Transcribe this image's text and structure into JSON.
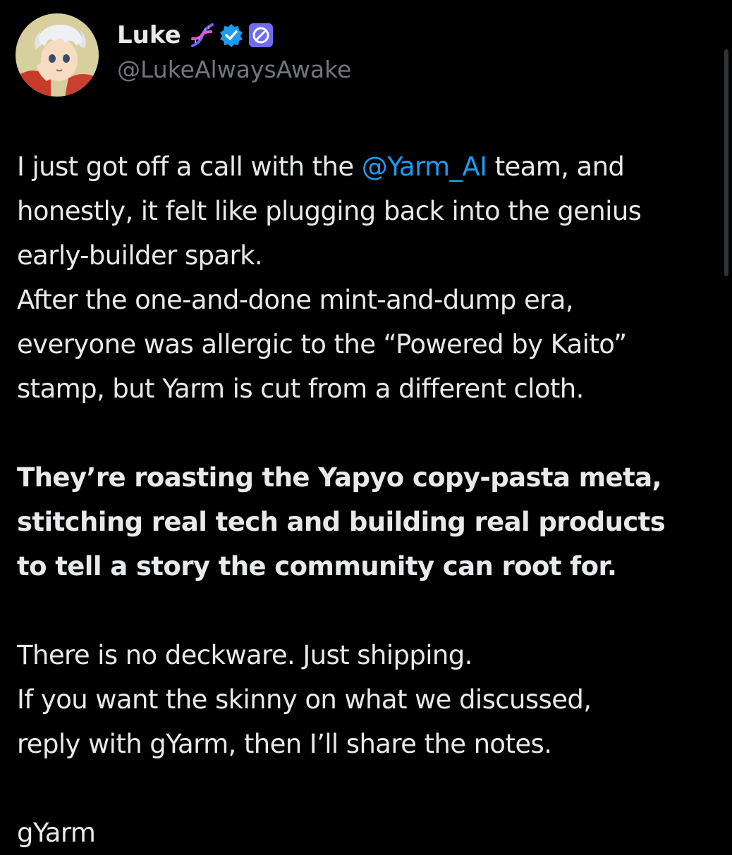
{
  "author": {
    "display_name": "Luke",
    "handle": "@LukeAlwaysAwake",
    "avatar_icon": "anime-avatar",
    "badges": [
      "dna-emoji-icon",
      "verified-badge-icon",
      "affiliate-badge-icon"
    ],
    "verified_color": "#1d9bf0",
    "affiliate_color": "#6f6cf2"
  },
  "tweet": {
    "para1": {
      "line1_pre": "I just got off a call with the ",
      "mention": "@Yarm_AI",
      "line1_post": " team, and",
      "line2": "honestly, it felt like plugging back into the genius",
      "line3": "early-builder spark.",
      "line4": "After the one-and-done mint-and-dump era,",
      "line5": "everyone was allergic to the “Powered by Kaito”",
      "line6": "stamp, but Yarm is cut from a different cloth."
    },
    "para2": {
      "line1": "They’re roasting the Yapyo copy-pasta meta,",
      "line2": "stitching real tech and building real products",
      "line3": "to tell a story the community can root for."
    },
    "para3": {
      "line1": "There is no deckware. Just shipping.",
      "line2": "If you want the skinny on what we discussed,",
      "line3": "reply with gYarm, then I’ll share the notes."
    },
    "para4": {
      "line1": "gYarm"
    }
  },
  "colors": {
    "background": "#000000",
    "text": "#e7e9ea",
    "secondary_text": "#71767b",
    "link": "#1d9bf0"
  }
}
